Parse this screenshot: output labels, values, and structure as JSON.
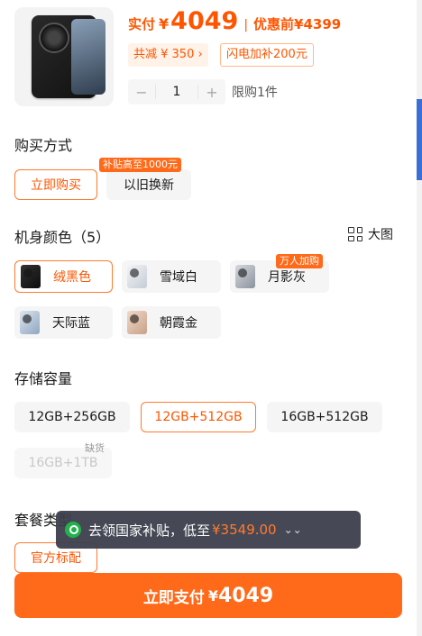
{
  "product": {
    "price_label": "实付",
    "currency": "¥",
    "price": "4049",
    "separator": "|",
    "before_label": "优惠前",
    "before_price": "¥4399",
    "discount_chip": "共减 ¥ 350 ›",
    "flash_chip": "闪电加补200元"
  },
  "quantity": {
    "minus": "−",
    "value": "1",
    "plus": "+",
    "limit": "限购1件"
  },
  "purchase_method": {
    "title": "购买方式",
    "options": [
      {
        "label": "立即购买",
        "selected": true
      },
      {
        "label": "以旧换新",
        "selected": false
      }
    ],
    "trade_in_tag": "补贴高至1000元"
  },
  "colors": {
    "title": "机身颜色（5）",
    "big_view": "大图",
    "options": [
      {
        "label": "绒黑色",
        "selected": true
      },
      {
        "label": "雪域白",
        "selected": false
      },
      {
        "label": "月影灰",
        "selected": false
      },
      {
        "label": "天际蓝",
        "selected": false
      },
      {
        "label": "朝霞金",
        "selected": false
      }
    ],
    "popular_tag": "万人加购"
  },
  "storage": {
    "title": "存储容量",
    "options": [
      {
        "label": "12GB+256GB",
        "selected": false
      },
      {
        "label": "12GB+512GB",
        "selected": true
      },
      {
        "label": "16GB+512GB",
        "selected": false
      },
      {
        "label": "16GB+1TB",
        "selected": false,
        "disabled": true
      }
    ],
    "out_of_stock": "缺货"
  },
  "package": {
    "title": "套餐类型",
    "options": [
      {
        "label": "官方标配",
        "selected": true
      }
    ]
  },
  "toast": {
    "text": "去领国家补贴，低至",
    "price": "¥3549.00",
    "chevron": "⌄⌄"
  },
  "pay_button": {
    "label": "立即支付",
    "currency": "¥",
    "amount": "4049"
  },
  "colors_theme": {
    "accent": "#ff6a1a",
    "price": "#ff5500",
    "toast_bg": "#3a3e4a",
    "wechat_green": "#22b14c"
  }
}
